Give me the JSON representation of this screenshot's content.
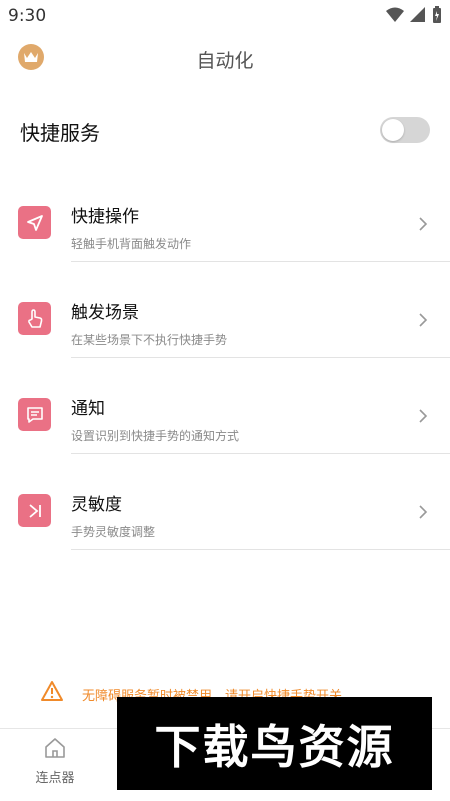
{
  "status": {
    "time": "9:30"
  },
  "header": {
    "title": "自动化"
  },
  "quick_service": {
    "label": "快捷服务",
    "enabled": false
  },
  "menu": [
    {
      "title": "快捷操作",
      "subtitle": "轻触手机背面触发动作",
      "icon": "send-icon"
    },
    {
      "title": "触发场景",
      "subtitle": "在某些场景下不执行快捷手势",
      "icon": "hand-tap-icon"
    },
    {
      "title": "通知",
      "subtitle": "设置识别到快捷手势的通知方式",
      "icon": "message-icon"
    },
    {
      "title": "灵敏度",
      "subtitle": "手势灵敏度调整",
      "icon": "skip-next-icon"
    }
  ],
  "warning": {
    "text": "无障碍服务暂时被禁用，请开启快捷手势开关"
  },
  "bottom_nav": [
    {
      "label": "连点器",
      "icon": "home-icon"
    }
  ],
  "watermark": {
    "text": "下载鸟资源"
  },
  "colors": {
    "accent": "#ea7185",
    "warning": "#f08a2a",
    "crown": "#e0a96b"
  }
}
